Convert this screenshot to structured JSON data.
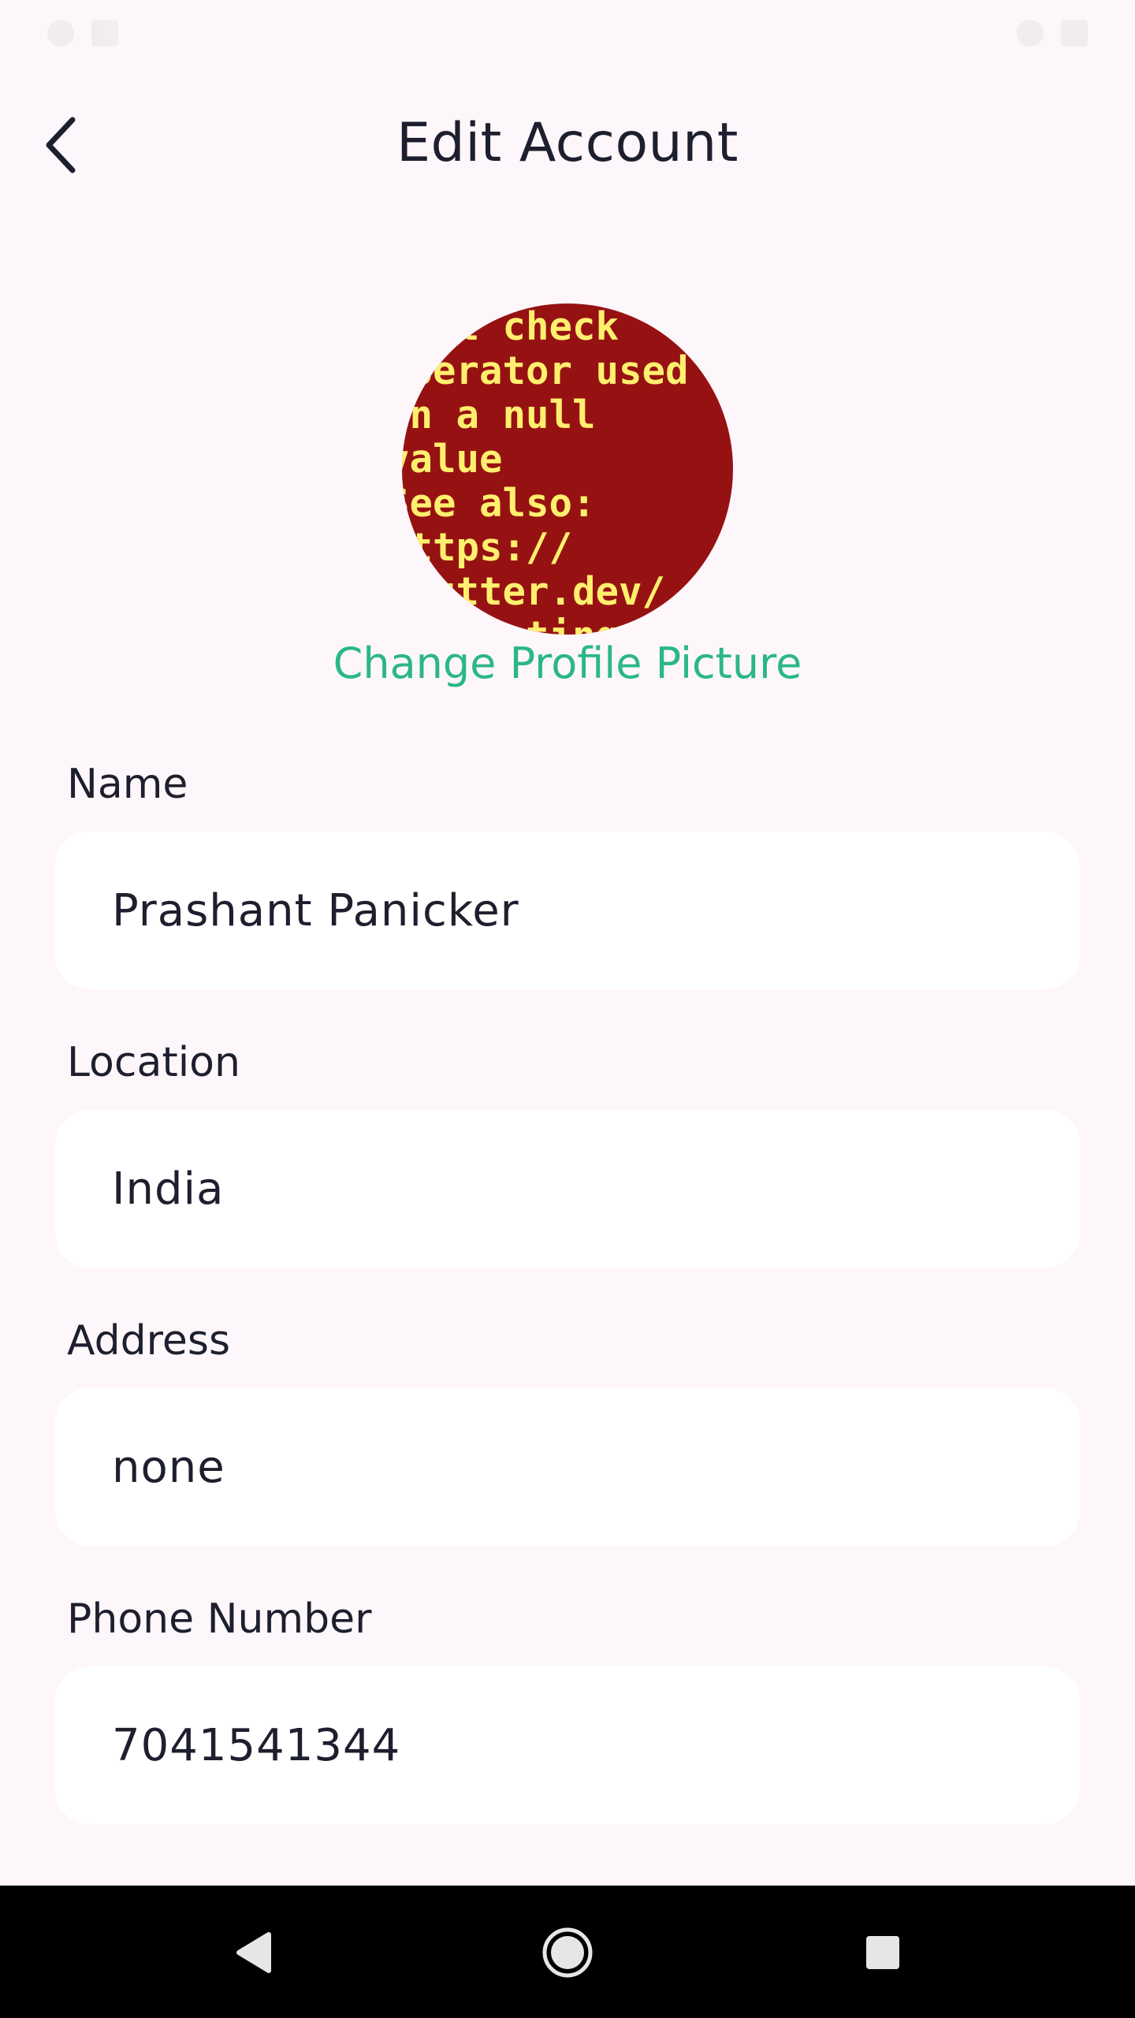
{
  "header": {
    "title": "Edit Account"
  },
  "avatar": {
    "error_lines": [
      "Null check",
      "operator used",
      "on a null",
      "value",
      "See also:",
      "https://",
      "flutter.dev/",
      "to/testing"
    ],
    "background": "#961212",
    "text_color": "#ffef6e"
  },
  "change_picture_label": "Change Profile Picture",
  "fields": {
    "name": {
      "label": "Name",
      "value": "Prashant Panicker"
    },
    "location": {
      "label": "Location",
      "value": "India"
    },
    "address": {
      "label": "Address",
      "value": "none"
    },
    "phone": {
      "label": "Phone Number",
      "value": "7041541344"
    }
  },
  "colors": {
    "accent": "#2bb788",
    "background": "#fdf7fb",
    "field_bg": "#ffffff",
    "text": "#1e1f2e"
  },
  "icons": {
    "back": "chevron-left-icon",
    "nav_back": "triangle-back-icon",
    "nav_home": "circle-home-icon",
    "nav_recent": "square-recents-icon"
  }
}
